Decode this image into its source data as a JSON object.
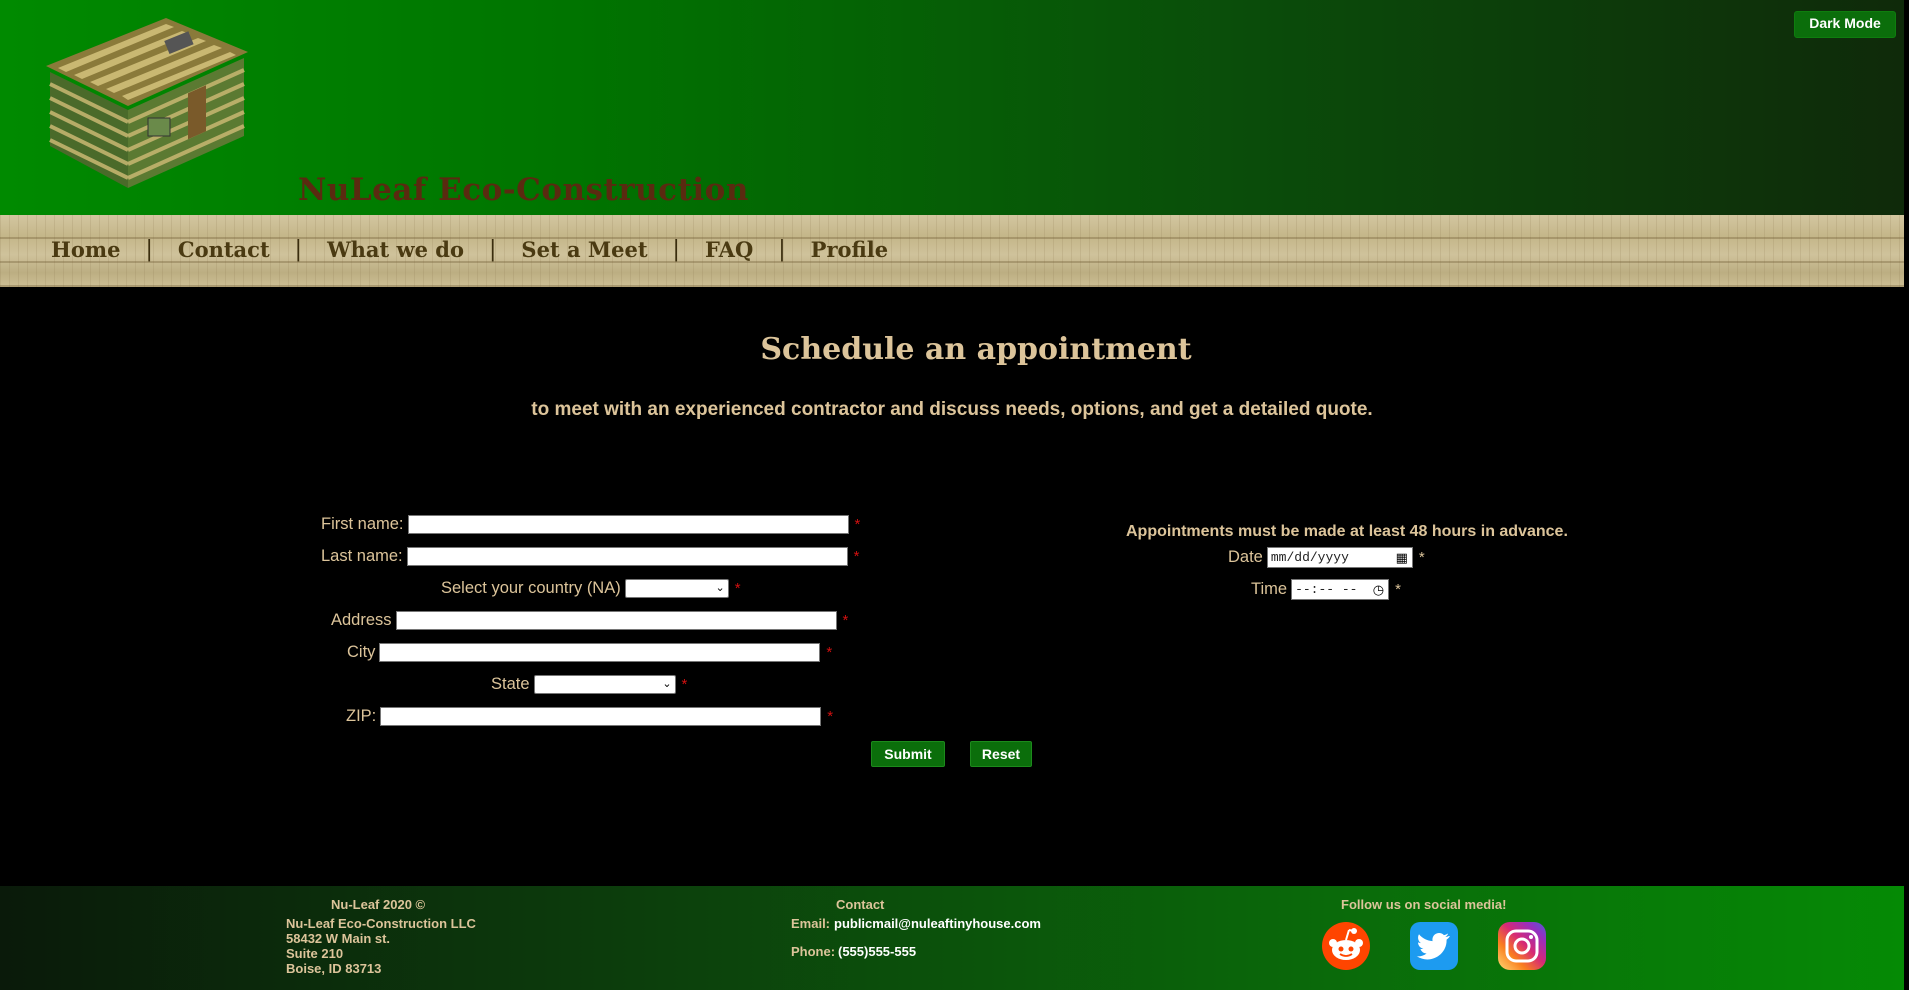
{
  "header": {
    "site_title": "NuLeaf Eco-Construction",
    "dark_mode_label": "Dark Mode"
  },
  "nav": {
    "items": [
      "Home",
      "Contact",
      "What we do",
      "Set a Meet",
      "FAQ",
      "Profile"
    ],
    "separator": "|"
  },
  "main": {
    "title": "Schedule an appointment",
    "subtitle": "to meet with an experienced contractor and discuss needs, options, and get a detailed quote."
  },
  "form": {
    "first_name_label": "First name:",
    "last_name_label": "Last name:",
    "country_label": "Select your country (NA)",
    "address_label": "Address",
    "city_label": "City",
    "state_label": "State",
    "zip_label": "ZIP:",
    "required_mark": "*",
    "submit_label": "Submit",
    "reset_label": "Reset"
  },
  "appointment": {
    "notice": "Appointments must be made at least 48 hours in advance.",
    "date_label": "Date",
    "date_placeholder": "mm/dd/yyyy",
    "time_label": "Time",
    "time_placeholder": "--:-- --"
  },
  "footer": {
    "copyright": "Nu-Leaf 2020 ©",
    "company": "Nu-Leaf Eco-Construction LLC",
    "street": "58432 W Main st.",
    "suite": "Suite 210",
    "city_state": "Boise, ID 83713",
    "contact_heading": "Contact",
    "email_label": "Email:",
    "email_value": "publicmail@nuleaftinyhouse.com",
    "phone_label": "Phone:",
    "phone_value": "(555)555-555",
    "social_heading": "Follow us on social media!",
    "social": [
      "reddit-icon",
      "twitter-icon",
      "instagram-icon"
    ]
  },
  "colors": {
    "accent_green": "#0b6e0b",
    "text_tan": "#dcc49a",
    "required_red": "#d21010"
  }
}
